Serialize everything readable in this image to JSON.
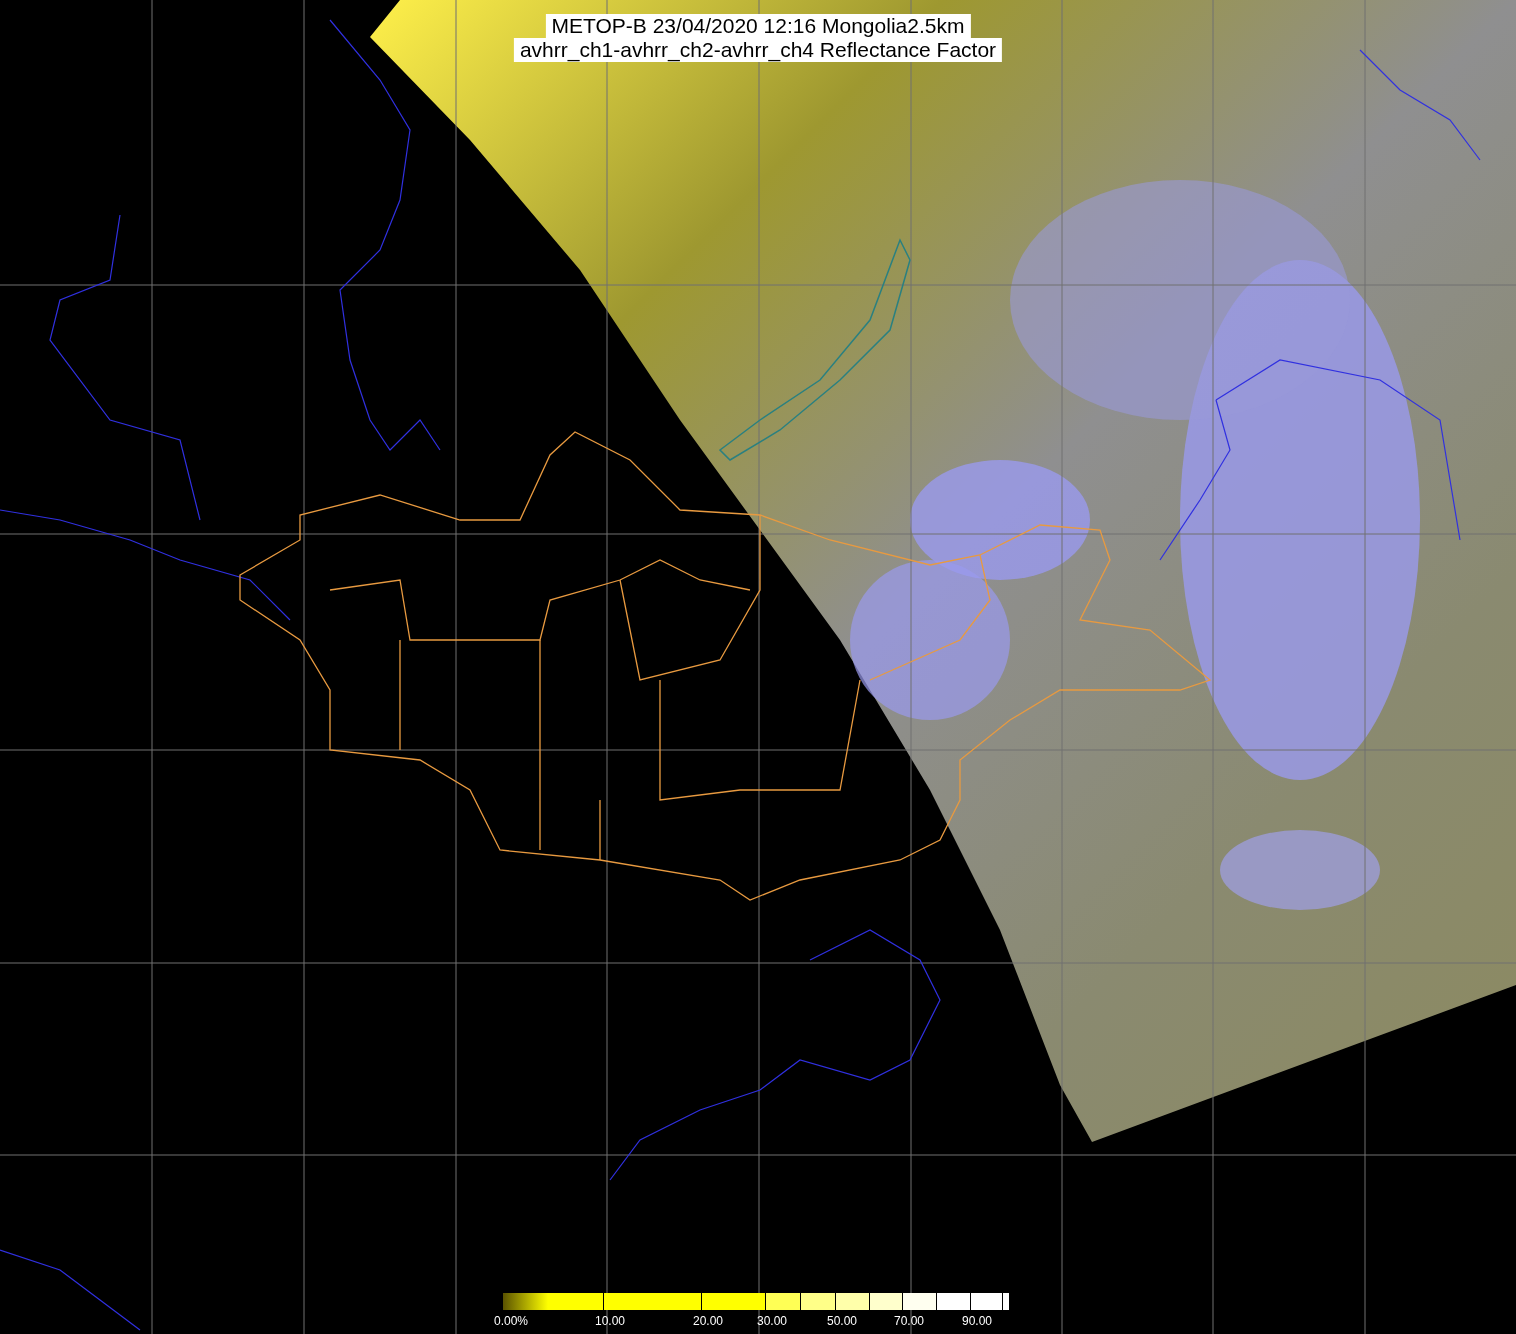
{
  "title": {
    "line_1": "METOP-B 23/04/2020 12:16 Mongolia2.5km",
    "line_2": "avhrr_ch1-avhrr_ch2-avhrr_ch4 Reflectance Factor"
  },
  "colorbar": {
    "segments": [
      {
        "color": "#ffff00"
      },
      {
        "color": "#ffff00"
      },
      {
        "color": "#ffff00"
      },
      {
        "color": "#ffff55"
      },
      {
        "color": "#ffff88"
      },
      {
        "color": "#ffffaa"
      },
      {
        "color": "#ffffcc"
      },
      {
        "color": "#fffff0"
      },
      {
        "color": "#ffffff"
      },
      {
        "color": "#ffffff"
      }
    ],
    "labels": [
      {
        "text": "0.00%"
      },
      {
        "text": "10.00"
      },
      {
        "text": "20.00"
      },
      {
        "text": "30.00"
      },
      {
        "text": "50.00"
      },
      {
        "text": "70.00"
      },
      {
        "text": "90.00"
      }
    ]
  }
}
